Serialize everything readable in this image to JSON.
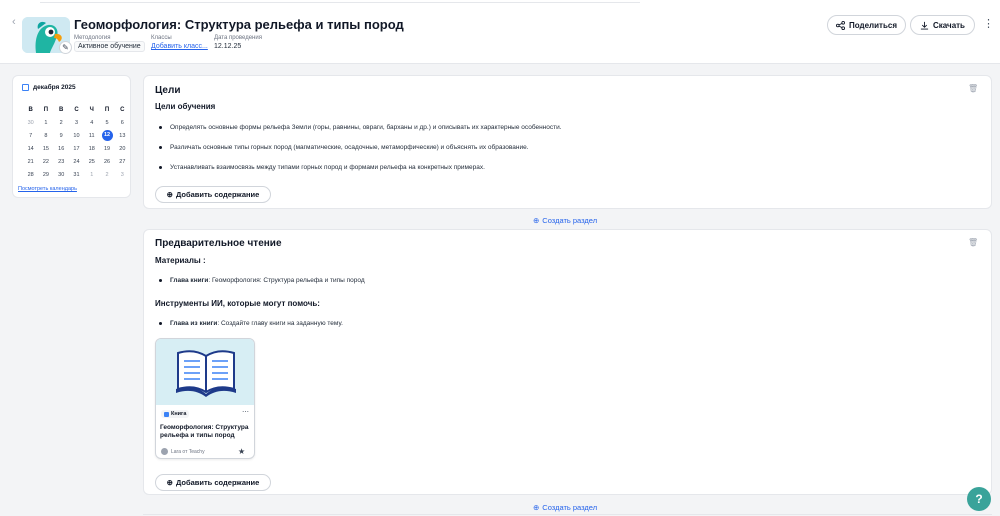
{
  "header": {
    "title": "Геоморфология: Структура рельефа и типы пород",
    "meta": [
      {
        "label": "Методология",
        "value": "Активное обучение"
      },
      {
        "label": "Классы",
        "value": "Добавить класс..."
      },
      {
        "label": "Дата проведения",
        "value": "12.12.25"
      }
    ],
    "share_label": "Поделиться",
    "download_label": "Скачать"
  },
  "calendar": {
    "month": "декабря 2025",
    "weekdays": [
      "В",
      "П",
      "В",
      "С",
      "Ч",
      "П",
      "С"
    ],
    "weeks": [
      [
        "30",
        "1",
        "2",
        "3",
        "4",
        "5",
        "6"
      ],
      [
        "7",
        "8",
        "9",
        "10",
        "11",
        "12",
        "13"
      ],
      [
        "14",
        "15",
        "16",
        "17",
        "18",
        "19",
        "20"
      ],
      [
        "21",
        "22",
        "23",
        "24",
        "25",
        "26",
        "27"
      ],
      [
        "28",
        "29",
        "30",
        "31",
        "1",
        "2",
        "3"
      ]
    ],
    "today": "12",
    "view_link": "Посмотреть календарь"
  },
  "goals": {
    "title": "Цели",
    "subtitle": "Цели обучения",
    "items": [
      "Определять основные формы рельефа Земли (горы, равнины, овраги, барханы и др.) и описывать их характерные особенности.",
      "Различать основные типы горных пород (магматические, осадочные, метаморфические) и объяснять их образование.",
      "Устанавливать взаимосвязь между типами горных пород и формами рельефа на конкретных примерах."
    ],
    "add_label": "Добавить содержание"
  },
  "create_section_label": "Создать раздел",
  "reading": {
    "title": "Предварительное чтение",
    "materials_title": "Материалы :",
    "materials": [
      {
        "bold": "Глава книги",
        "text": ": Геоморфология: Структура рельефа и типы пород"
      }
    ],
    "tools_title": "Инструменты ИИ, которые могут помочь:",
    "tools": [
      {
        "bold": "Глава из книги",
        "text": ": Создайте главу книги на заданную тему."
      }
    ],
    "card": {
      "badge": "Книга",
      "title": "Геоморфология: Структура рельефа и типы пород",
      "author": "Lara от Teachy",
      "icon": "book-icon"
    },
    "add_label": "Добавить содержание"
  },
  "help_label": "?"
}
